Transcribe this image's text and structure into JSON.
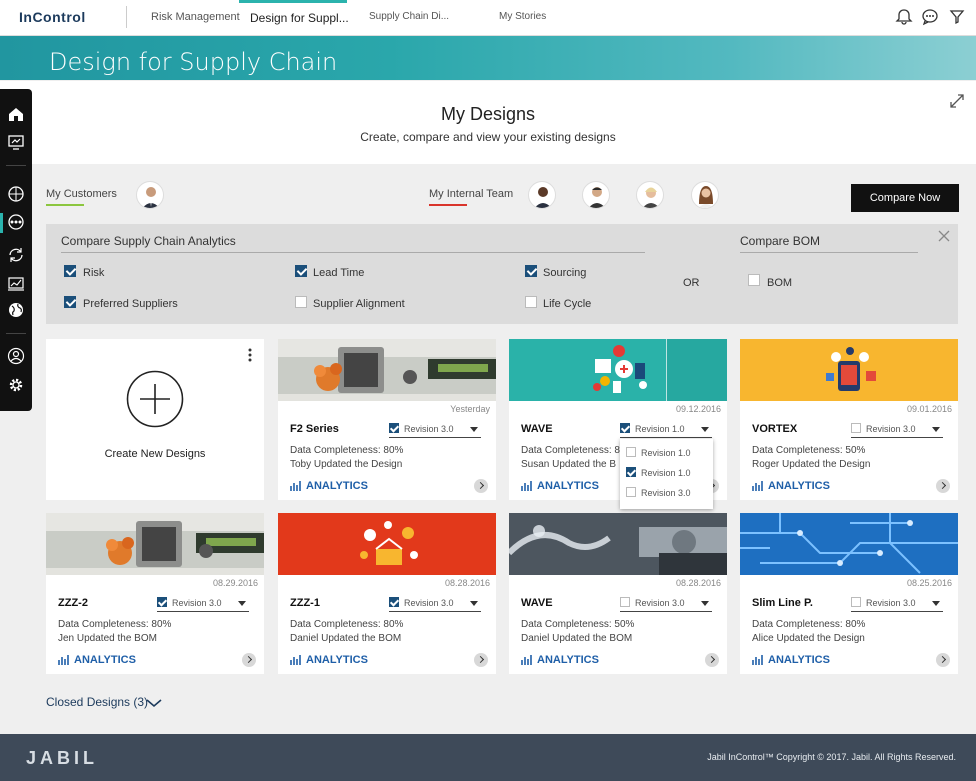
{
  "app": {
    "logo": "InControl"
  },
  "nav": {
    "tabs": [
      {
        "label": "Risk Management"
      },
      {
        "label": "Design for Suppl..."
      },
      {
        "label": "Supply Chain Di..."
      },
      {
        "label": "My Stories"
      }
    ]
  },
  "banner": {
    "title": "Design for Supply Chain"
  },
  "hero": {
    "title": "My Designs",
    "subtitle": "Create, compare and view your existing designs"
  },
  "team": {
    "customers_label": "My Customers",
    "internal_label": "My Internal Team",
    "compare_now": "Compare Now"
  },
  "compare": {
    "analytics_title": "Compare Supply Chain Analytics",
    "bom_title": "Compare BOM",
    "or": "OR",
    "options": [
      {
        "label": "Risk",
        "checked": true
      },
      {
        "label": "Lead Time",
        "checked": true
      },
      {
        "label": "Sourcing",
        "checked": true
      },
      {
        "label": "Preferred Suppliers",
        "checked": true
      },
      {
        "label": "Supplier Alignment",
        "checked": false
      },
      {
        "label": "Life Cycle",
        "checked": false
      }
    ],
    "bom": {
      "label": "BOM",
      "checked": false
    }
  },
  "create": {
    "label": "Create New Designs"
  },
  "cards": [
    {
      "title": "F2 Series",
      "date": "Yesterday",
      "revision": "Revision 3.0",
      "rev_checked": true,
      "completeness": "Data Completeness: 80%",
      "update": "Toby Updated the Design",
      "analytics": "ANALYTICS"
    },
    {
      "title": "WAVE",
      "date": "09.12.2016",
      "revision": "Revision 1.0",
      "rev_checked": true,
      "completeness": "Data Completeness: 8",
      "update": "Susan Updated the B",
      "analytics": "ANALYTICS"
    },
    {
      "title": "VORTEX",
      "date": "09.01.2016",
      "revision": "Revision 3.0",
      "rev_checked": false,
      "completeness": "Data Completeness: 50%",
      "update": "Roger Updated the Design",
      "analytics": "ANALYTICS"
    },
    {
      "title": "ZZZ-2",
      "date": "08.29.2016",
      "revision": "Revision 3.0",
      "rev_checked": true,
      "completeness": "Data Completeness: 80%",
      "update": "Jen Updated the BOM",
      "analytics": "ANALYTICS"
    },
    {
      "title": "ZZZ-1",
      "date": "08.28.2016",
      "revision": "Revision 3.0",
      "rev_checked": true,
      "completeness": "Data Completeness: 80%",
      "update": "Daniel Updated the BOM",
      "analytics": "ANALYTICS"
    },
    {
      "title": "WAVE",
      "date": "08.28.2016",
      "revision": "Revision 3.0",
      "rev_checked": false,
      "completeness": "Data Completeness: 50%",
      "update": "Daniel Updated the BOM",
      "analytics": "ANALYTICS"
    },
    {
      "title": "Slim Line P.",
      "date": "08.25.2016",
      "revision": "Revision 3.0",
      "rev_checked": false,
      "completeness": "Data Completeness: 80%",
      "update": "Alice Updated the Design",
      "analytics": "ANALYTICS"
    }
  ],
  "dropdown": {
    "items": [
      {
        "label": "Revision 1.0",
        "checked": false
      },
      {
        "label": "Revision 1.0",
        "checked": true
      },
      {
        "label": "Revision 3.0",
        "checked": false
      }
    ]
  },
  "closed": {
    "label": "Closed Designs (3)"
  },
  "footer": {
    "brand": "JABIL",
    "copyright": "Jabil InControl™ Copyright © 2017. Jabil. All Rights Reserved."
  },
  "colors": {
    "accent": "#2bb3ad",
    "primary": "#1f5fa8",
    "dark": "#111111",
    "footer": "#3e4a59"
  }
}
